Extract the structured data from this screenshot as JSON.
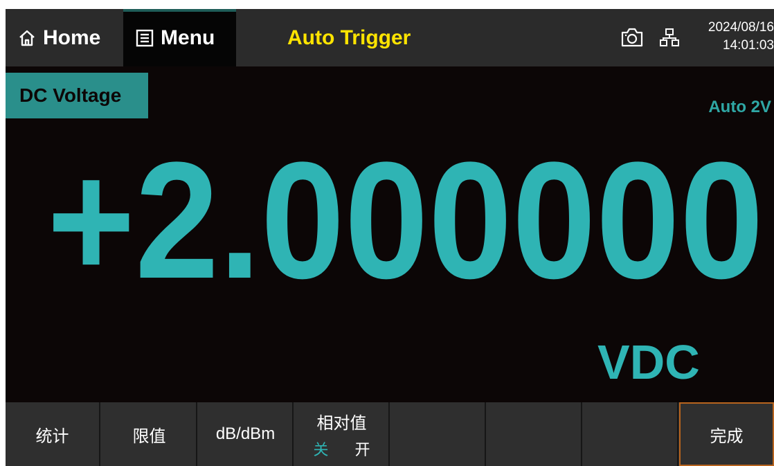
{
  "topbar": {
    "home_label": "Home",
    "menu_label": "Menu",
    "trigger_mode": "Auto Trigger",
    "date": "2024/08/16",
    "time": "14:01:03"
  },
  "measurement": {
    "function": "DC Voltage",
    "range": "Auto 2V",
    "reading": "+2.000000",
    "unit": "VDC"
  },
  "softkeys": {
    "statistics": "统计",
    "limit": "限值",
    "db_dbm": "dB/dBm",
    "relative": "相对值",
    "relative_off": "关",
    "relative_on": "开",
    "done": "完成"
  },
  "icons": [
    "home-icon",
    "menu-list-icon",
    "camera-icon",
    "network-icon"
  ],
  "colors": {
    "accent": "#2fb4b4",
    "trigger": "#ffe400",
    "function_bg": "#2a8f8b",
    "active_border": "#b8641e"
  }
}
